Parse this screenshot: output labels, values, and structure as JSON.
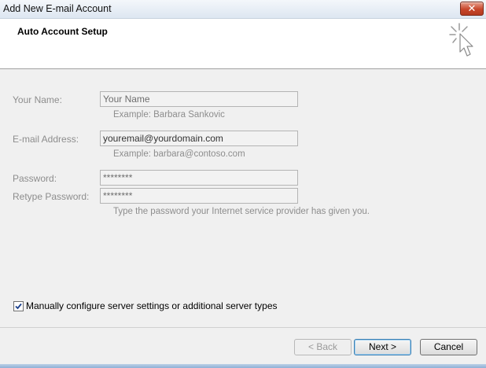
{
  "window": {
    "title": "Add New E-mail Account",
    "close_label": "✕"
  },
  "header": {
    "heading": "Auto Account Setup"
  },
  "form": {
    "name_label": "Your Name:",
    "name_value": "Your Name",
    "name_hint": "Example: Barbara Sankovic",
    "email_label": "E-mail Address:",
    "email_value": "youremail@yourdomain.com",
    "email_hint": "Example: barbara@contoso.com",
    "password_label": "Password:",
    "password_value": "********",
    "retype_label": "Retype Password:",
    "retype_value": "********",
    "password_hint": "Type the password your Internet service provider has given you."
  },
  "options": {
    "manual_config_label": "Manually configure server settings or additional server types",
    "manual_config_checked": true
  },
  "buttons": {
    "back": "< Back",
    "next": "Next >",
    "cancel": "Cancel"
  }
}
